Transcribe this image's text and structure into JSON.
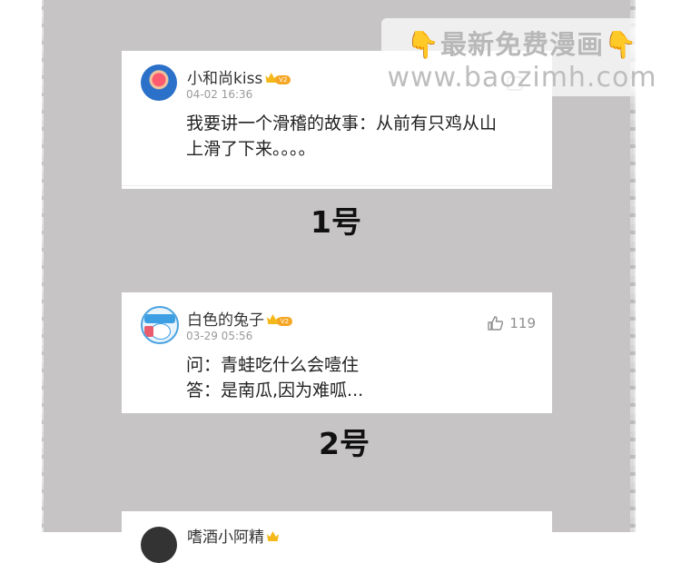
{
  "watermark": {
    "title": "最新免费漫画",
    "url": "www.baozimh.com",
    "icon": "pointing-down-hand-icon"
  },
  "comments": [
    {
      "username": "小和尚kiss",
      "vip": "V2",
      "time": "04-02 16:36",
      "content_line1": "我要讲一个滑稽的故事：从前有只鸡从山",
      "content_line2": "上滑了下来。。。。"
    },
    {
      "username": "白色的兔子",
      "vip": "V2",
      "time": "03-29 05:56",
      "likes": "119",
      "content_line1": "问：青蛙吃什么会噎住",
      "content_line2": "答：是南瓜,因为难呱..."
    },
    {
      "username": "嗜酒小阿精"
    }
  ],
  "labels": [
    "1号",
    "2号"
  ],
  "colors": {
    "panel": "#c7c4c5",
    "card": "#ffffff",
    "vip_gold": "#f5a623",
    "text": "#222222",
    "meta": "#9a9a9a"
  }
}
